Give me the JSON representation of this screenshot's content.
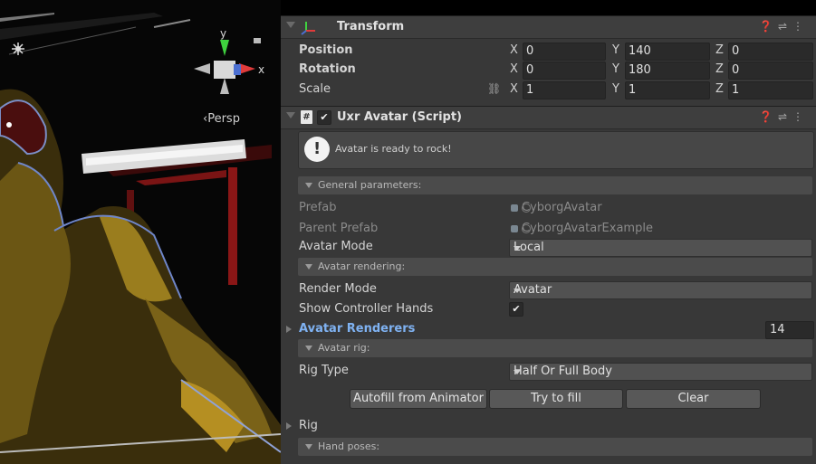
{
  "scene": {
    "gizmo": {
      "y_label": "y",
      "x_label": "x"
    },
    "persp_label": "‹Persp"
  },
  "transform": {
    "title": "Transform",
    "rows": [
      {
        "label": "Position",
        "x": "0",
        "y": "140",
        "z": "0"
      },
      {
        "label": "Rotation",
        "x": "0",
        "y": "180",
        "z": "0"
      },
      {
        "label": "Scale",
        "x": "1",
        "y": "1",
        "z": "1"
      }
    ]
  },
  "uxr_avatar": {
    "title": "Uxr Avatar (Script)",
    "enabled": true,
    "help_message": "Avatar is ready to rock!",
    "sections": {
      "general": "General parameters:",
      "rendering": "Avatar rendering:",
      "rig": "Avatar rig:",
      "hand_poses": "Hand poses:"
    },
    "prefab": {
      "label": "Prefab",
      "value": "CyborgAvatar"
    },
    "parent_prefab": {
      "label": "Parent Prefab",
      "value": "CyborgAvatarExample"
    },
    "avatar_mode": {
      "label": "Avatar Mode",
      "value": "Local"
    },
    "render_mode": {
      "label": "Render Mode",
      "value": "Avatar"
    },
    "show_controller_hands": {
      "label": "Show Controller Hands",
      "checked": true,
      "check_glyph": "✔"
    },
    "avatar_renderers": {
      "label": "Avatar Renderers",
      "count": "14"
    },
    "rig_type": {
      "label": "Rig Type",
      "value": "Half Or Full Body"
    },
    "buttons": {
      "autofill": "Autofill from Animator",
      "try_fill": "Try to fill",
      "clear": "Clear"
    },
    "rig": {
      "label": "Rig"
    }
  },
  "axis_letters": {
    "x": "X",
    "y": "Y",
    "z": "Z"
  },
  "colors": {
    "inspector_bg": "#383838",
    "header_bg": "#3e3e3e",
    "link_blue": "#7fb2f2",
    "scene_bg": "#050505"
  }
}
